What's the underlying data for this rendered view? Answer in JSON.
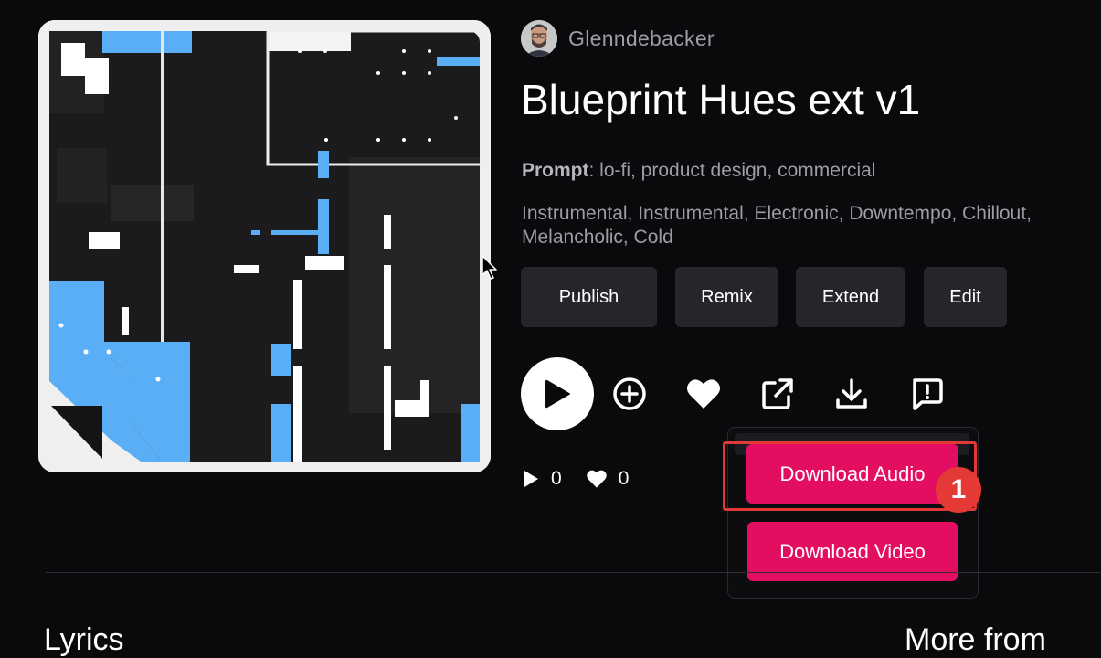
{
  "song": {
    "author": "Glenndebacker",
    "title": "Blueprint Hues ext v1",
    "prompt_label": "Prompt",
    "prompt_text": ": lo-fi, product design, commercial",
    "tags_line1": "Instrumental, Instrumental, Electronic, Downtempo, Chillout,",
    "tags_line2": "Melancholic, Cold"
  },
  "actions": {
    "publish": "Publish",
    "remix": "Remix",
    "extend": "Extend",
    "edit": "Edit"
  },
  "icons": [
    "play-icon",
    "add-circle-icon",
    "heart-icon",
    "share-external-icon",
    "download-icon",
    "report-icon"
  ],
  "stats": {
    "plays": "0",
    "likes": "0"
  },
  "download_menu": {
    "audio": "Download Audio",
    "video": "Download Video"
  },
  "annotation": {
    "step": "1",
    "highlight_color": "#e33838"
  },
  "bottom": {
    "left_partial": "Lyrics",
    "right_partial": "More from"
  },
  "colors": {
    "accent": "#e30d61",
    "cover_blue": "#5aaef5",
    "button_bg": "#26262a"
  }
}
